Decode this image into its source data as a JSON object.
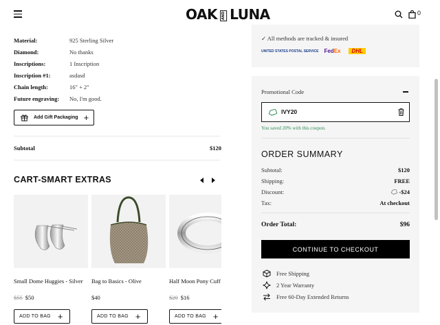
{
  "header": {
    "logo_left": "OAK",
    "logo_mid": "AND",
    "logo_right": "LUNA",
    "cart_count": "0"
  },
  "details": [
    {
      "label": "Material:",
      "value": "925 Sterling Silver"
    },
    {
      "label": "Diamond:",
      "value": "No thanks"
    },
    {
      "label": "Inscriptions:",
      "value": "1 Inscription"
    },
    {
      "label": "Inscription #1:",
      "value": "asdasd"
    },
    {
      "label": "Chain length:",
      "value": "16\" + 2\""
    },
    {
      "label": "Future engraving:",
      "value": "No, I'm good."
    }
  ],
  "gift_button": {
    "label": "Add Gift Packaging",
    "plus": "+"
  },
  "subtotal": {
    "label": "Subtotal",
    "value": "$120"
  },
  "extras": {
    "title": "CART-SMART EXTRAS",
    "products": [
      {
        "name": "Small Dome Huggies - Silver",
        "old_price": "$55",
        "price": "$50",
        "button": "ADD TO BAG"
      },
      {
        "name": "Bag to Basics - Olive",
        "old_price": "",
        "price": "$40",
        "button": "ADD TO BAG"
      },
      {
        "name": "Half Moon Pony Cuff",
        "old_price": "$20",
        "price": "$16",
        "button": "ADD TO BAG"
      }
    ]
  },
  "shipping_info": {
    "secure_text": "✓ All methods are tracked & insured",
    "carriers": {
      "usps": "UNITED STATES POSTAL SERVICE",
      "fedex_a": "Fed",
      "fedex_b": "Ex",
      "dhl": "DHL"
    }
  },
  "promo": {
    "label": "Promotional Code",
    "code": "IVY20",
    "saved_text": "You saved 20% with this coupon."
  },
  "summary": {
    "title": "ORDER SUMMARY",
    "subtotal_label": "Subtotal:",
    "subtotal_value": "$120",
    "shipping_label": "Shipping:",
    "shipping_value": "FREE",
    "discount_label": "Discount:",
    "discount_value": "-$24",
    "tax_label": "Tax:",
    "tax_value": "At checkout",
    "total_label": "Order Total:",
    "total_value": "$96",
    "checkout_button": "CONTINUE TO CHECKOUT"
  },
  "perks": [
    {
      "icon": "box-icon",
      "text": "Free Shipping"
    },
    {
      "icon": "sparkle-icon",
      "text": "2 Year Warranty"
    },
    {
      "icon": "exchange-icon",
      "text": "Free 60-Day Extended Returns"
    }
  ],
  "colors": {
    "accent": "#000000",
    "success": "#2e8b57",
    "panel_bg": "#f5f5f5"
  }
}
